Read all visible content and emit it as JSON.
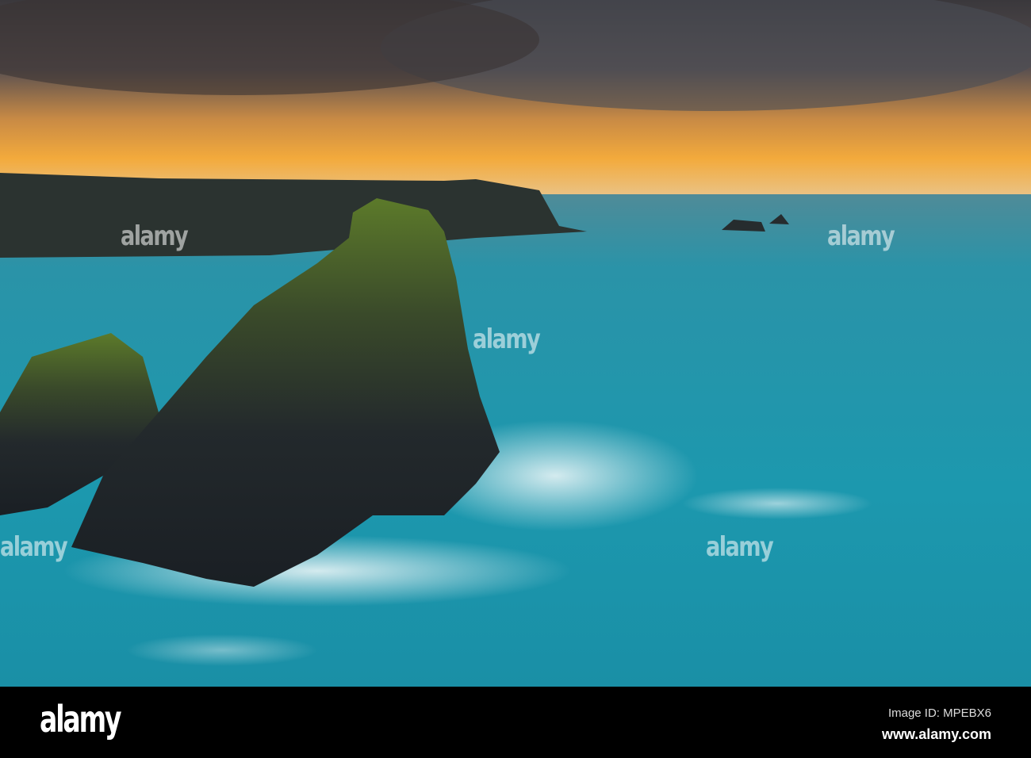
{
  "photo": {
    "subject": "Sea stack at sunset",
    "colors": {
      "sky_top": "#3c3a3e",
      "sky_glow": "#f2a43a",
      "sea": "#1a8ca3",
      "rock": "#22282c",
      "moss": "#5a6e2a"
    }
  },
  "watermark": {
    "text": "alamy"
  },
  "footer": {
    "logo": "alamy",
    "image_id": "Image ID: MPEBX6",
    "website": "www.alamy.com"
  }
}
